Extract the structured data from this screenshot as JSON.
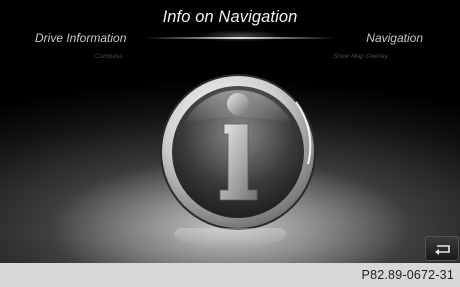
{
  "header": {
    "title": "Info on Navigation"
  },
  "menu": {
    "left": {
      "label": "Drive Information",
      "sublabel": "Compass"
    },
    "right": {
      "label": "Navigation",
      "sublabel": "Show Map Overlay"
    }
  },
  "main": {
    "icon": "info-icon"
  },
  "controls": {
    "back_icon": "back-arrow-icon"
  },
  "footer": {
    "caption": "P82.89-0672-31"
  }
}
